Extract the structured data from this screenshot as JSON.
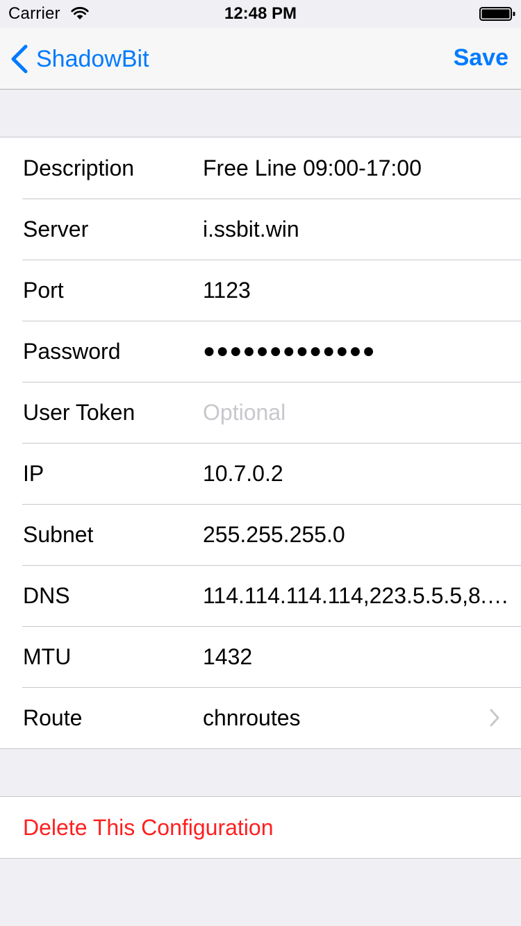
{
  "status_bar": {
    "carrier": "Carrier",
    "time": "12:48 PM"
  },
  "nav": {
    "back_label": "ShadowBit",
    "save_label": "Save",
    "accent_color": "#007aff"
  },
  "form": {
    "rows": [
      {
        "label": "Description",
        "value": "Free Line 09:00-17:00"
      },
      {
        "label": "Server",
        "value": "i.ssbit.win"
      },
      {
        "label": "Port",
        "value": "1123"
      },
      {
        "label": "Password",
        "value": "●●●●●●●●●●●●●"
      },
      {
        "label": "User Token",
        "placeholder": "Optional"
      },
      {
        "label": "IP",
        "value": "10.7.0.2"
      },
      {
        "label": "Subnet",
        "value": "255.255.255.0"
      },
      {
        "label": "DNS",
        "value": "114.114.114.114,223.5.5.5,8.8…"
      },
      {
        "label": "MTU",
        "value": "1432"
      },
      {
        "label": "Route",
        "value": "chnroutes"
      }
    ]
  },
  "delete": {
    "label": "Delete This Configuration",
    "color": "#ff1f1f"
  },
  "icons": [
    "wifi-icon",
    "battery-icon",
    "back-chevron-icon",
    "chevron-right-icon"
  ]
}
